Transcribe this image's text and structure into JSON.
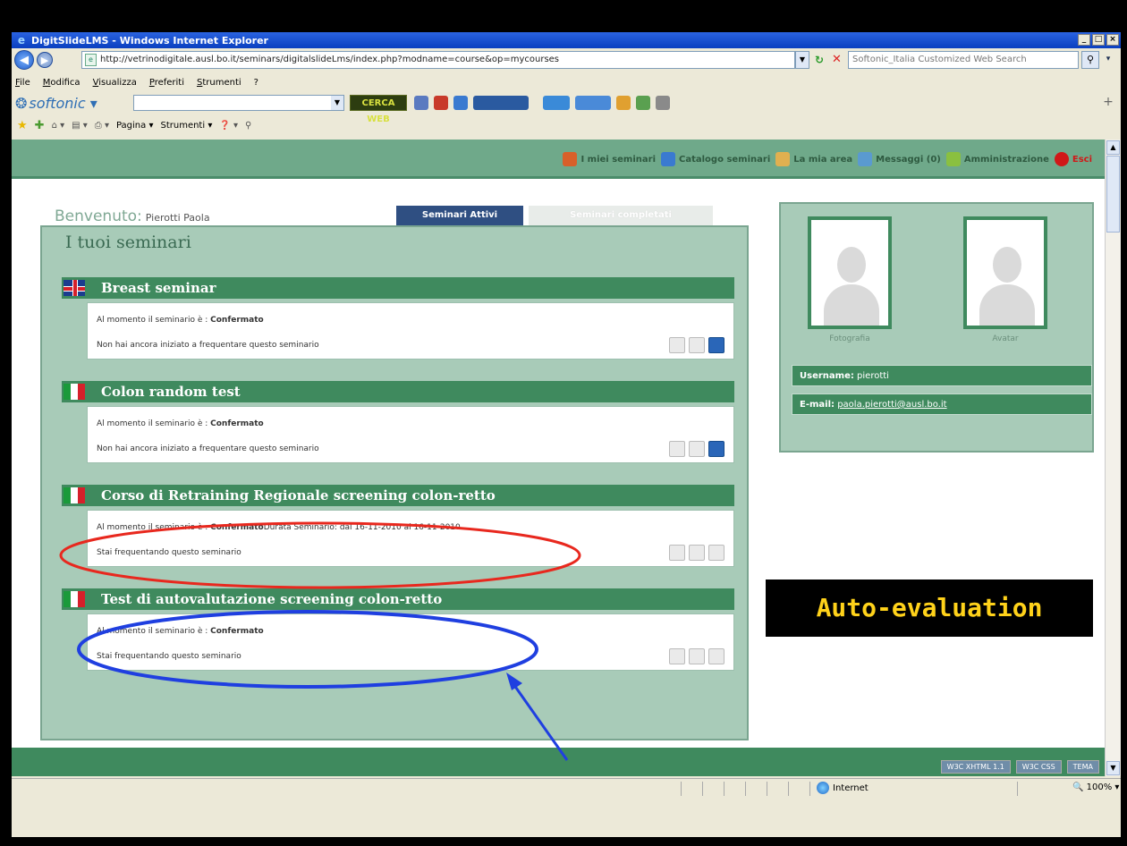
{
  "window": {
    "title": "DigitSlideLMS - Windows Internet Explorer",
    "url": "http://vetrinodigitale.ausl.bo.it/seminars/digitalslideLms/index.php?modname=course&op=mycourses",
    "search_placeholder": "Softonic_Italia Customized Web Search"
  },
  "menu": [
    "File",
    "Modifica",
    "Visualizza",
    "Preferiti",
    "Strumenti",
    "?"
  ],
  "softonic": {
    "brand": "softonic",
    "cerca_label": "CERCA WEB"
  },
  "command_bar": {
    "pagina": "Pagina",
    "strumenti": "Strumenti"
  },
  "nav": {
    "my_seminars": "I miei seminari",
    "catalog": "Catalogo seminari",
    "my_area": "La mia area",
    "messages": "Messaggi (0)",
    "admin": "Amministrazione",
    "logout": "Esci"
  },
  "welcome": {
    "label": "Benvenuto:",
    "name": "Pierotti Paola"
  },
  "tabs": {
    "active": "Seminari Attivi",
    "completed": "Seminari completati"
  },
  "panel_title": "I tuoi seminari",
  "seminars": [
    {
      "title": "Breast seminar",
      "flag": "uk",
      "status_prefix": "Al momento il seminario è : ",
      "status": "Confermato",
      "duration": "",
      "attendance": "Non hai ancora iniziato a frequentare questo seminario"
    },
    {
      "title": "Colon random test",
      "flag": "it",
      "status_prefix": "Al momento il seminario è : ",
      "status": "Confermato",
      "duration": "",
      "attendance": "Non hai ancora iniziato a frequentare questo seminario"
    },
    {
      "title": "Corso di Retraining Regionale screening colon-retto",
      "flag": "it",
      "status_prefix": "Al momento il seminario è : ",
      "status": "Confermato",
      "duration": "Durata Seminario: dal 16-11-2010 al 16-11-2010.",
      "attendance": "Stai frequentando questo seminario"
    },
    {
      "title": "Test di autovalutazione screening colon-retto",
      "flag": "it",
      "status_prefix": "Al momento il seminario è : ",
      "status": "Confermato",
      "duration": "",
      "attendance": "Stai frequentando questo seminario"
    }
  ],
  "profile": {
    "photo_label": "Fotografia",
    "avatar_label": "Avatar",
    "username_label": "Username:",
    "username": "pierotti",
    "email_label": "E-mail:",
    "email": "paola.pierotti@ausl.bo.it"
  },
  "footer_badges": [
    "W3C XHTML 1.1",
    "W3C CSS",
    "TEMA"
  ],
  "status": {
    "zone": "Internet",
    "zoom": "100%"
  },
  "annotation": {
    "label": "Auto-evaluation",
    "label_color": "#ffd21a",
    "red_ring_color": "#e8281e",
    "blue_ring_color": "#1f3fe0"
  },
  "colors": {
    "nav_green": "#6fa98a",
    "header_green": "#3f8a5e",
    "panel_green": "#a8cbb8",
    "tab_blue": "#2f4f82"
  }
}
